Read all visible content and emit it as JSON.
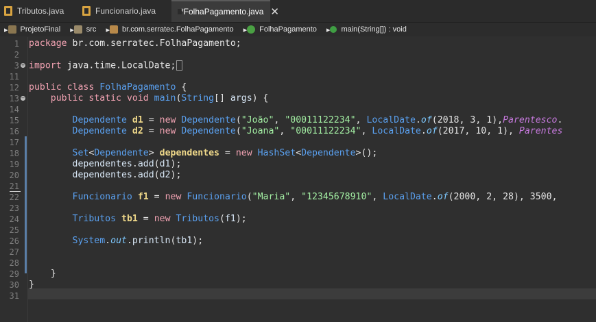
{
  "tabs": [
    {
      "label": "Tributos.java",
      "active": false
    },
    {
      "label": "Funcionario.java",
      "active": false
    },
    {
      "label": "*FolhaPagamento.java",
      "active": true
    }
  ],
  "close_glyph": "✕",
  "breadcrumb": [
    {
      "label": "ProjetoFinal",
      "icon": "project-icon"
    },
    {
      "label": "src",
      "icon": "source-folder-icon"
    },
    {
      "label": "br.com.serratec.FolhaPagamento",
      "icon": "package-icon"
    },
    {
      "label": "FolhaPagamento",
      "icon": "class-icon"
    },
    {
      "label": "main(String[]) : void",
      "icon": "method-icon"
    }
  ],
  "line_numbers": [
    "1",
    "2",
    "3",
    "11",
    "12",
    "13",
    "14",
    "15",
    "16",
    "17",
    "18",
    "19",
    "20",
    "21",
    "22",
    "23",
    "24",
    "25",
    "26",
    "27",
    "28",
    "29",
    "30",
    "31"
  ],
  "code_lines": [
    "package br.com.serratec.FolhaPagamento;",
    "",
    "import java.time.LocalDate;",
    "",
    "public class FolhaPagamento {",
    "    public static void main(String[] args) {",
    "",
    "        Dependente d1 = new Dependente(\"João\", \"00011122234\", LocalDate.of(2018, 3, 1),Parentesco.",
    "        Dependente d2 = new Dependente(\"Joana\", \"00011122234\", LocalDate.of(2017, 10, 1), Parentes",
    "",
    "        Set<Dependente> dependentes = new HashSet<Dependente>();",
    "        dependentes.add(d1);",
    "        dependentes.add(d2);",
    "",
    "        Funcionario f1 = new Funcionario(\"Maria\", \"12345678910\", LocalDate.of(2000, 2, 28), 3500, ",
    "",
    "        Tributos tb1 = new Tributos(f1);",
    "",
    "        System.out.println(tb1);",
    "",
    "",
    "    }",
    "}",
    ""
  ],
  "colors": {
    "background": "#2f2f2f",
    "keyword": "#f2a3b3",
    "type": "#1290c3",
    "string": "#a4f0a4",
    "italic_field": "#c679dd"
  }
}
